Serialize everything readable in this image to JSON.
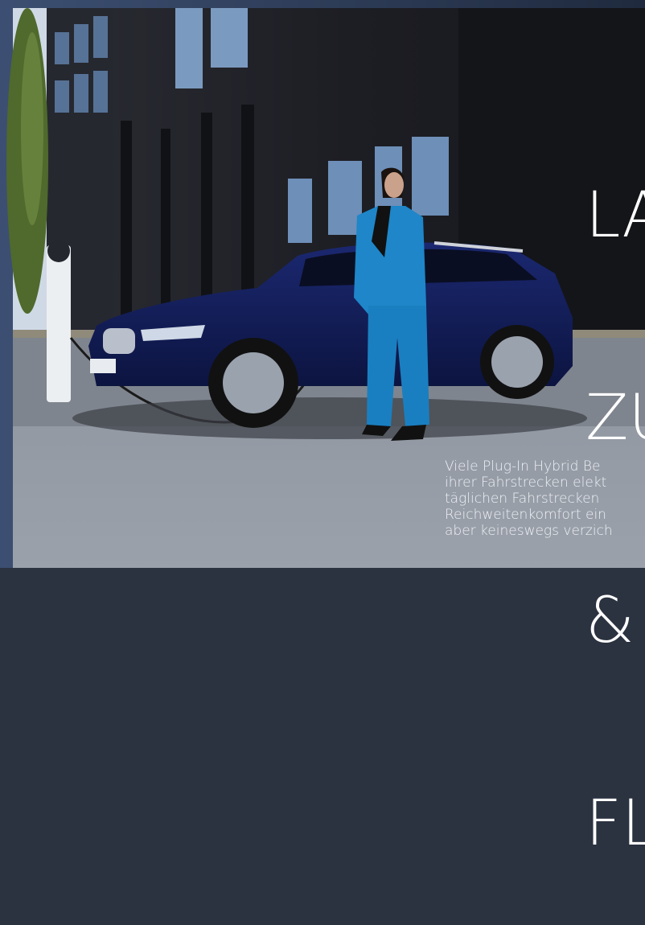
{
  "headline": {
    "lines": [
      "LA",
      "ZU",
      "&",
      "FL"
    ]
  },
  "body": {
    "lines": [
      "Viele Plug-In Hybrid Be",
      "ihrer Fahrstrecken elekt",
      "täglichen Fahrstrecken",
      "Reichweitenkomfort ein",
      "aber keineswegs verzich"
    ]
  },
  "colors": {
    "car": "#121d52",
    "suit": "#1e86c9",
    "sky": "#dfe6ee",
    "building": "#1c1d22"
  }
}
